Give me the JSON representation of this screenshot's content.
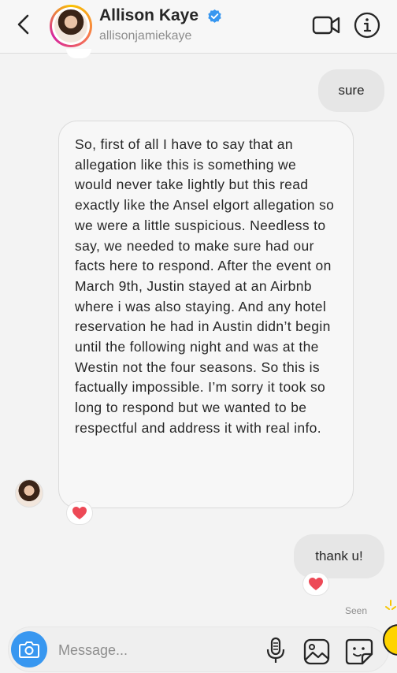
{
  "header": {
    "name": "Allison Kaye",
    "handle": "allisonjamiekaye",
    "icons": [
      "back-icon",
      "verified-icon",
      "video-call-icon",
      "info-icon"
    ]
  },
  "messages": {
    "outgoing_1": "sure",
    "incoming_1": "So, first of all I have to say that an allegation like this is something we would never take lightly but this read exactly like the Ansel elgort allegation so we were a little suspicious. Needless to say, we needed to make sure had our facts here to respond. After the event on March 9th, Justin stayed at an Airbnb where i was also staying. And any hotel reservation he had in Austin didn’t begin until the following night and was at the Westin not the four seasons. So this is factually impossible. I’m sorry it took so long to respond but we wanted to be respectful and address it with real info.",
    "outgoing_2": "thank u!",
    "reaction": "❤️",
    "seen": "Seen"
  },
  "composer": {
    "placeholder": "Message...",
    "icons": [
      "camera-icon",
      "microphone-icon",
      "gallery-icon",
      "sticker-icon"
    ]
  },
  "colors": {
    "accent_blue": "#3897f0",
    "verified_blue": "#3897f0",
    "heart_red": "#ed4956",
    "bubble_out": "#e6e6e6"
  }
}
